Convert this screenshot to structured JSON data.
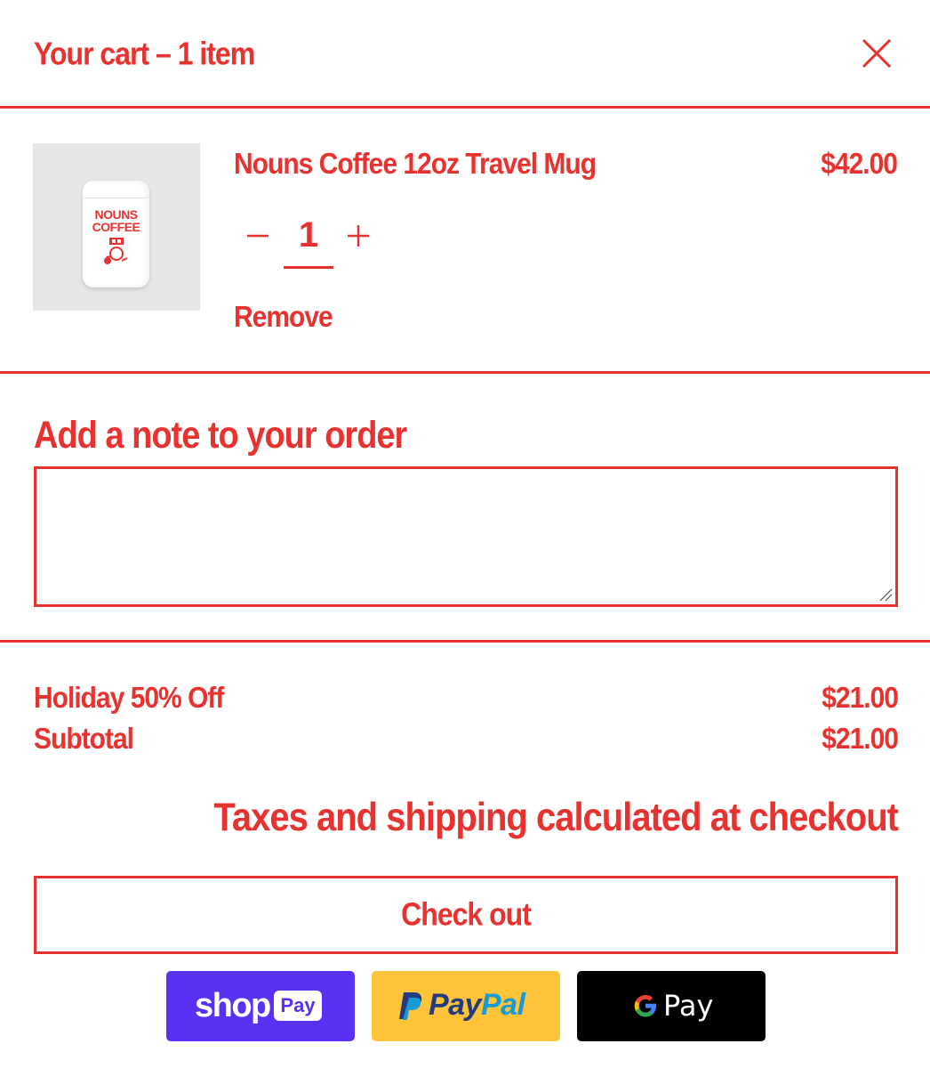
{
  "header": {
    "title": "Your cart – 1 item"
  },
  "item": {
    "image_text_line1": "NOUNS",
    "image_text_line2": "COFFEE",
    "name": "Nouns Coffee 12oz Travel Mug",
    "price": "$42.00",
    "quantity": "1",
    "remove_label": "Remove"
  },
  "note": {
    "label": "Add a note to your order",
    "value": "",
    "placeholder": ""
  },
  "summary": {
    "discount_label": "Holiday 50% Off",
    "discount_value": "$21.00",
    "subtotal_label": "Subtotal",
    "subtotal_value": "$21.00",
    "taxes_note": "Taxes and shipping calculated at checkout"
  },
  "checkout": {
    "label": "Check out"
  },
  "payments": {
    "shop_word": "shop",
    "shop_badge": "Pay",
    "paypal_a": "Pay",
    "paypal_b": "Pal",
    "gpay_word": "Pay"
  },
  "colors": {
    "accent": "#e8322f",
    "shop": "#5a31f4",
    "paypal": "#ffc439",
    "gpay": "#000000"
  }
}
